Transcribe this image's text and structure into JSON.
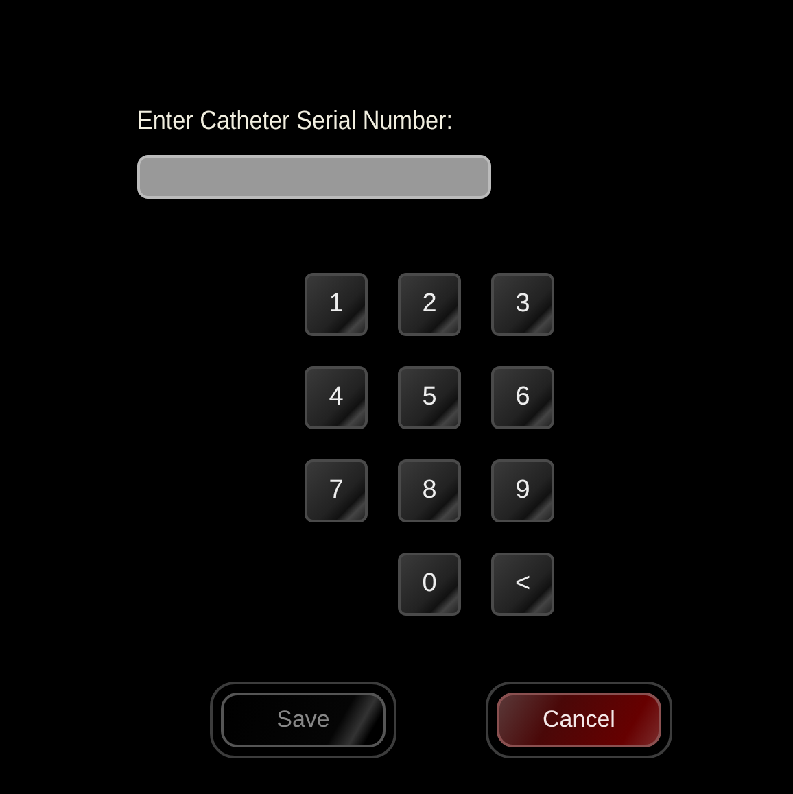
{
  "prompt": "Enter Catheter Serial Number:",
  "keypad": {
    "rows": [
      [
        "1",
        "2",
        "3"
      ],
      [
        "4",
        "5",
        "6"
      ],
      [
        "7",
        "8",
        "9"
      ],
      [
        "",
        "0",
        "<"
      ]
    ]
  },
  "buttons": [
    {
      "label": "Save",
      "kind": "neutral",
      "disabled": true
    },
    {
      "label": "Cancel",
      "kind": "danger",
      "disabled": false
    }
  ]
}
